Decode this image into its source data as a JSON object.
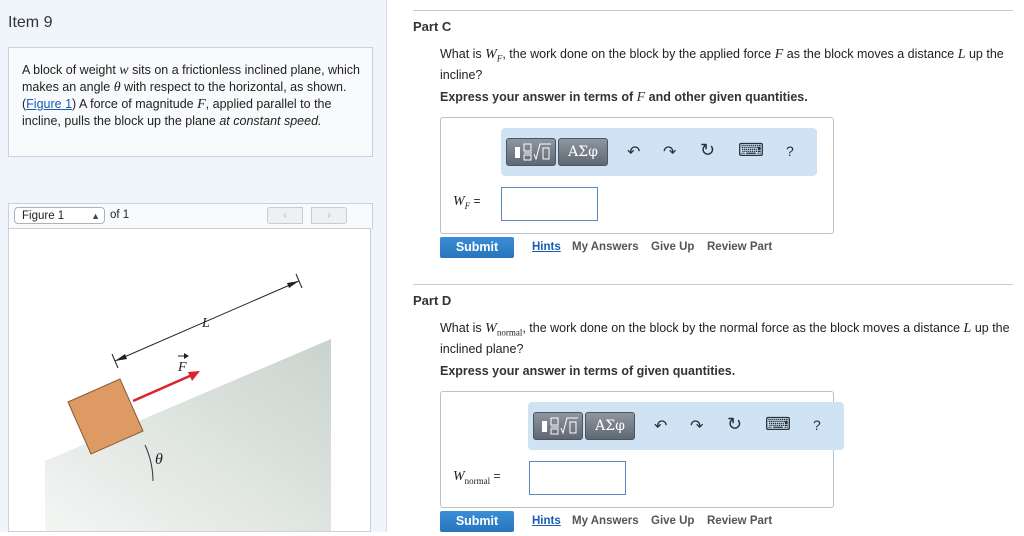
{
  "item": {
    "title": "Item 9"
  },
  "problem": {
    "t1": "A block of weight ",
    "w": "w",
    "t2": " sits on a frictionless inclined plane, which makes an angle ",
    "theta": "θ",
    "t3": " with respect to the horizontal, as shown. (",
    "figure_link": "Figure 1",
    "t4": ") A force of magnitude ",
    "F": "F",
    "t5": ", applied parallel to the incline, pulls the block up the plane ",
    "t6": "at constant speed."
  },
  "figure": {
    "select_label": "Figure 1",
    "of_label": "of 1",
    "prev_icon": "‹",
    "next_icon": "›",
    "label_L": "L",
    "label_F": "F",
    "label_theta": "θ"
  },
  "parts": [
    {
      "title": "Part C",
      "q1": "What is ",
      "q_sym": "W",
      "q_sub": "F",
      "q2": ", the work done on the block by the applied force ",
      "q_F": "F",
      "q3": " as the block moves a distance ",
      "q_L": "L",
      "q4": " up the incline?",
      "express1": "Express your answer in terms of ",
      "express_F": "F",
      "express2": " and other given quantities.",
      "eq_sym": "W",
      "eq_sub": "F",
      "eq_sign": " =",
      "input_value": "",
      "toolbar": {
        "greek": "ΑΣφ",
        "undo": "↶",
        "redo": "↷",
        "reset": "↻",
        "keyboard": "⌨",
        "help": "?"
      },
      "submit": "Submit",
      "hints": "Hints",
      "my_answers": "My Answers",
      "give_up": "Give Up",
      "review": "Review Part"
    },
    {
      "title": "Part D",
      "q1": "What is ",
      "q_sym": "W",
      "q_sub": "normal",
      "q2": ", the work done on the block by the normal force as the block moves a distance ",
      "q_L": "L",
      "q3": " up the inclined plane?",
      "express": "Express your answer in terms of given quantities.",
      "eq_sym": "W",
      "eq_sub": "normal",
      "eq_sign": " =",
      "input_value": "",
      "toolbar": {
        "greek": "ΑΣφ",
        "undo": "↶",
        "redo": "↷",
        "reset": "↻",
        "keyboard": "⌨",
        "help": "?"
      },
      "submit": "Submit",
      "hints": "Hints",
      "my_answers": "My Answers",
      "give_up": "Give Up",
      "review": "Review Part"
    }
  ],
  "colors": {
    "accent": "#2874bd",
    "link": "#1a5bb8",
    "block": "#dd9a62",
    "force_arrow": "#d9232e",
    "toolbar_bg": "#cfe3f5"
  }
}
